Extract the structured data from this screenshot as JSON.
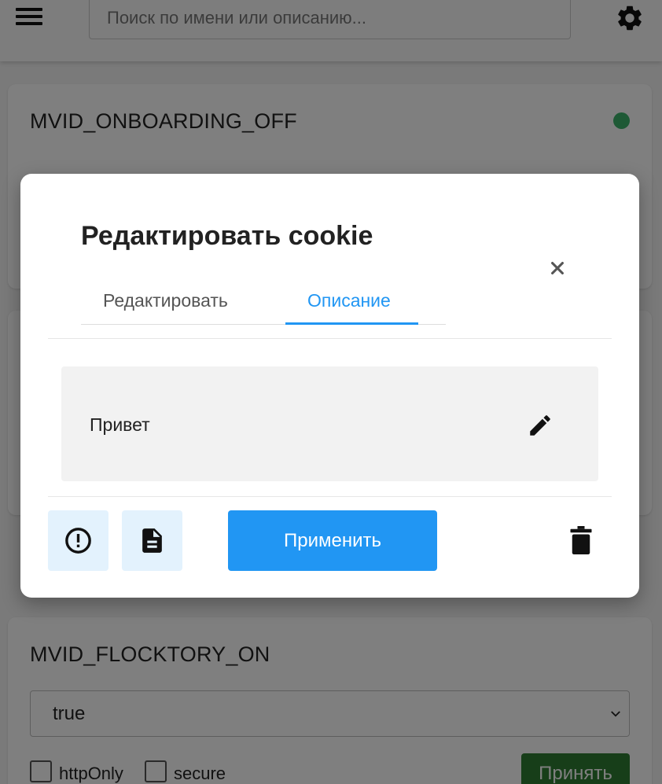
{
  "header": {
    "search_placeholder": "Поиск по имени или описанию..."
  },
  "cards": [
    {
      "name": "MVID_ONBOARDING_OFF",
      "status_color": "#3cb36a"
    },
    {
      "name": "MVID_FLOCKTORY_ON",
      "value": "true",
      "http_only_label": "httpOnly",
      "secure_label": "secure",
      "accept_label": "Принять"
    }
  ],
  "modal": {
    "title": "Редактировать cookie",
    "tabs": [
      "Редактировать",
      "Описание"
    ],
    "active_tab": "Описание",
    "description": "Привет",
    "apply_label": "Применить"
  },
  "colors": {
    "accent": "#2196f3",
    "accept": "#2e7d32",
    "icon_button_bg": "#e3f2fd"
  },
  "icons": {
    "menu": "hamburger-icon",
    "settings": "gear-icon",
    "close": "close-icon",
    "edit": "pencil-icon",
    "info": "exclamation-circle-icon",
    "doc": "document-icon",
    "delete": "trash-icon",
    "select": "chevron-down-icon"
  }
}
